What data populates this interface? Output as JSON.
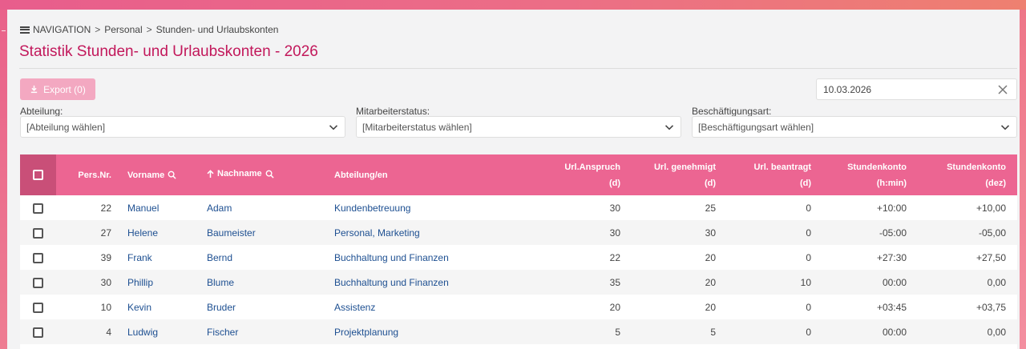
{
  "breadcrumb": {
    "nav": "NAVIGATION",
    "level1": "Personal",
    "level2": "Stunden- und Urlaubskonten"
  },
  "page": {
    "title": "Statistik Stunden- und Urlaubskonten - 2026"
  },
  "toolbar": {
    "export_label": "Export (0)",
    "date_value": "10.03.2026"
  },
  "filters": {
    "department": {
      "label": "Abteilung:",
      "value": "[Abteilung wählen]"
    },
    "status": {
      "label": "Mitarbeiterstatus:",
      "value": "[Mitarbeiterstatus wählen]"
    },
    "employment": {
      "label": "Beschäftigungsart:",
      "value": "[Beschäftigungsart wählen]"
    }
  },
  "table": {
    "headers": {
      "persnr": "Pers.Nr.",
      "vorname": "Vorname",
      "nachname": "Nachname",
      "abteilung": "Abteilung/en",
      "anspruch_1": "Url.Anspruch",
      "anspruch_2": "(d)",
      "genehmigt_1": "Url. genehmigt",
      "genehmigt_2": "(d)",
      "beantragt_1": "Url. beantragt",
      "beantragt_2": "(d)",
      "konto_hmin_1": "Stundenkonto",
      "konto_hmin_2": "(h:min)",
      "konto_dez_1": "Stundenkonto",
      "konto_dez_2": "(dez)"
    },
    "rows": [
      {
        "persnr": "22",
        "vorname": "Manuel",
        "nachname": "Adam",
        "abteilung": "Kundenbetreuung",
        "anspruch": "30",
        "genehmigt": "25",
        "beantragt": "0",
        "konto_hmin": "+10:00",
        "konto_dez": "+10,00"
      },
      {
        "persnr": "27",
        "vorname": "Helene",
        "nachname": "Baumeister",
        "abteilung": "Personal, Marketing",
        "anspruch": "30",
        "genehmigt": "30",
        "beantragt": "0",
        "konto_hmin": "-05:00",
        "konto_dez": "-05,00"
      },
      {
        "persnr": "39",
        "vorname": "Frank",
        "nachname": "Bernd",
        "abteilung": "Buchhaltung und Finanzen",
        "anspruch": "22",
        "genehmigt": "20",
        "beantragt": "0",
        "konto_hmin": "+27:30",
        "konto_dez": "+27,50"
      },
      {
        "persnr": "30",
        "vorname": "Phillip",
        "nachname": "Blume",
        "abteilung": "Buchhaltung und Finanzen",
        "anspruch": "35",
        "genehmigt": "20",
        "beantragt": "10",
        "konto_hmin": "00:00",
        "konto_dez": "0,00"
      },
      {
        "persnr": "10",
        "vorname": "Kevin",
        "nachname": "Bruder",
        "abteilung": "Assistenz",
        "anspruch": "20",
        "genehmigt": "20",
        "beantragt": "0",
        "konto_hmin": "+03:45",
        "konto_dez": "+03,75"
      },
      {
        "persnr": "4",
        "vorname": "Ludwig",
        "nachname": "Fischer",
        "abteilung": "Projektplanung",
        "anspruch": "5",
        "genehmigt": "5",
        "beantragt": "0",
        "konto_hmin": "00:00",
        "konto_dez": "0,00"
      }
    ]
  },
  "colors": {
    "accent": "#c2185b",
    "header_bg": "#ec6592",
    "link": "#1d4f91"
  }
}
